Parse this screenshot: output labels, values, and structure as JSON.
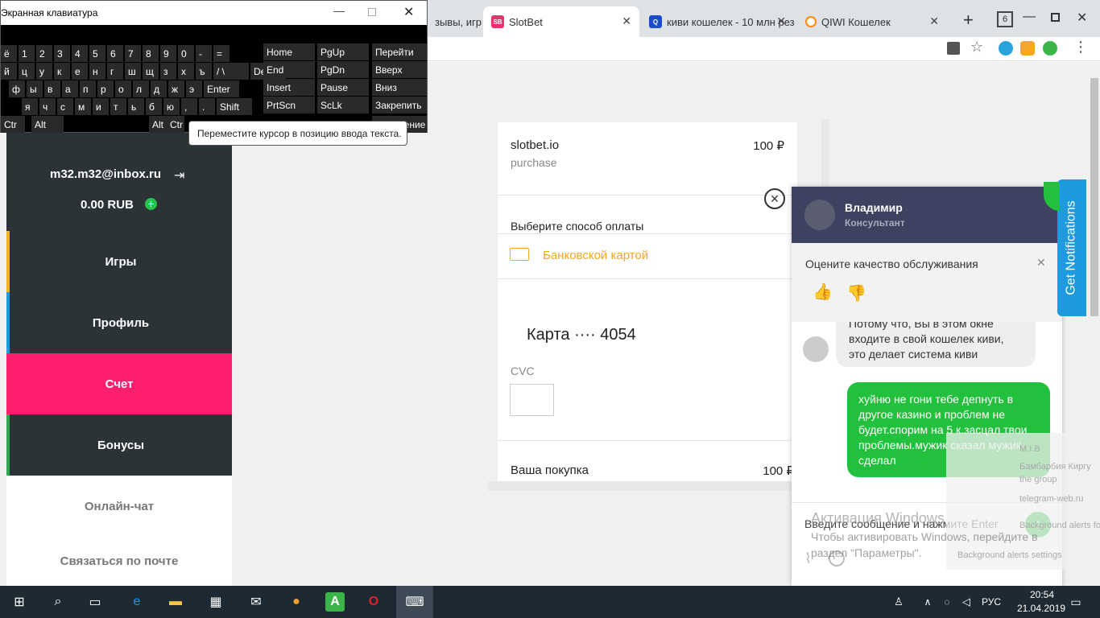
{
  "tabs": [
    {
      "label": "зывы, игр"
    },
    {
      "label": "SlotBet",
      "fav": "SB"
    },
    {
      "label": "киви кошелек - 10 млн резу"
    },
    {
      "label": "QIWI Кошелек"
    }
  ],
  "tab_count": "6",
  "keyboard": {
    "title": "Экранная клавиатура",
    "row1": [
      "ё",
      "1",
      "2",
      "3",
      "4",
      "5",
      "6",
      "7",
      "8",
      "9",
      "0",
      "-",
      "="
    ],
    "row2": [
      "й",
      "ц",
      "у",
      "к",
      "е",
      "н",
      "г",
      "ш",
      "щ",
      "з",
      "х",
      "ъ",
      "/ \\",
      "Del"
    ],
    "row3": [
      "ф",
      "ы",
      "в",
      "а",
      "п",
      "р",
      "о",
      "л",
      "д",
      "ж",
      "э",
      "Enter"
    ],
    "row4": [
      "я",
      "ч",
      "с",
      "м",
      "и",
      "т",
      "ь",
      "б",
      "ю",
      ",",
      ".",
      "Shift"
    ],
    "row5": [
      "Ctr",
      "Alt",
      "Alt",
      "Ctr"
    ],
    "side": [
      [
        "Home",
        "PgUp",
        "Перейти"
      ],
      [
        "End",
        "PgDn",
        "Вверх"
      ],
      [
        "Insert",
        "Pause",
        "Вниз"
      ],
      [
        "PrtScn",
        "ScLk",
        "Закрепить"
      ]
    ],
    "side_last": "Изменение",
    "tooltip": "Переместите курсор в позицию ввода текста."
  },
  "sidebar": {
    "email": "m32.m32@inbox.ru",
    "balance": "0.00 RUB",
    "items": [
      "Игры",
      "Профиль",
      "Счет",
      "Бонусы",
      "Онлайн-чат",
      "Связаться по почте"
    ]
  },
  "payment": {
    "merchant": "slotbet.io",
    "amount": "100 ₽",
    "purpose": "purchase",
    "choose": "Выберите способ оплаты",
    "method": "Банковской картой",
    "card": "Карта ···· 4054",
    "cvc": "CVC",
    "total_label": "Ваша покупка",
    "total": "100 ₽"
  },
  "chat": {
    "agent": "Владимир",
    "role": "Консультант",
    "rate": "Оцените качество обслуживания",
    "msg_in": "Потому что, Вы в этом окне входите в свой кошелек киви, это делает система киви",
    "msg_out": "хуйню не гони тебе депнуть в другое казино и проблем не будет.спорим на 5 к.засцал твои проблемы.мужик сказал мужик сделал",
    "input_placeholder": "Введите сообщение и нажмите Enter"
  },
  "notify_btn": "Get Notifications",
  "notif_ghost": [
    "M.I.B",
    "Бамбарбия Киргу",
    "the group",
    "telegram-web.ru",
    "Background alerts for 1 day",
    "Background alerts settings"
  ],
  "activation": {
    "title": "Активация Windows",
    "text": "Чтобы активировать Windows, перейдите в раздел \"Параметры\"."
  },
  "taskbar": {
    "lang": "РУС",
    "time": "20:54",
    "date": "21.04.2019"
  },
  "colors": {
    "active_nav": "#ff1f6e",
    "chat_header": "#3c4260",
    "outgoing": "#22c03c",
    "accent_orange": "#f5a623"
  }
}
